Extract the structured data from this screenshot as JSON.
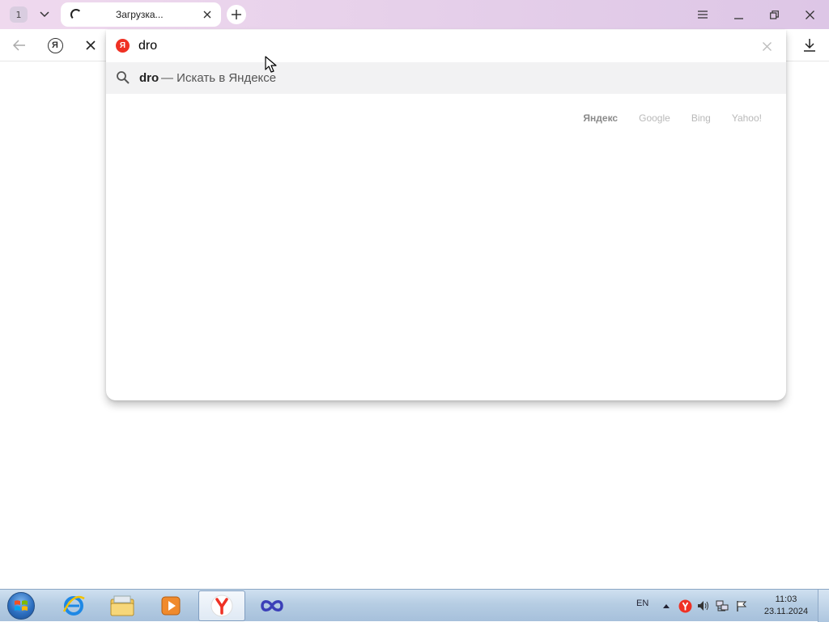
{
  "tabstrip": {
    "tab_count": "1",
    "active_tab": {
      "title": "Загрузка..."
    }
  },
  "omnibox": {
    "value": "dro",
    "favicon_letter": "Я"
  },
  "toolbar": {
    "yandex_button_letter": "Я"
  },
  "suggestions": [
    {
      "query": "dro",
      "description": "— Искать в Яндексе",
      "icon": "search-icon"
    }
  ],
  "search_engines": [
    {
      "label": "Яндекс",
      "selected": true
    },
    {
      "label": "Google",
      "selected": false
    },
    {
      "label": "Bing",
      "selected": false
    },
    {
      "label": "Yahoo!",
      "selected": false
    }
  ],
  "taskbar": {
    "apps": [
      {
        "name": "internet-explorer",
        "icon": "ie-icon"
      },
      {
        "name": "file-explorer",
        "icon": "folder-icon"
      },
      {
        "name": "media-player",
        "icon": "media-player-icon"
      },
      {
        "name": "yandex-browser",
        "icon": "yandex-browser-icon",
        "active": true
      },
      {
        "name": "infinity-app",
        "icon": "infinity-icon"
      }
    ],
    "language": "EN",
    "time": "11:03",
    "date": "23.11.2024"
  },
  "colors": {
    "tabstrip": "#e6d0ea",
    "yandex_red": "#ef3124",
    "suggestion_highlight": "#f2f2f3",
    "taskbar": "#b6cde3"
  }
}
